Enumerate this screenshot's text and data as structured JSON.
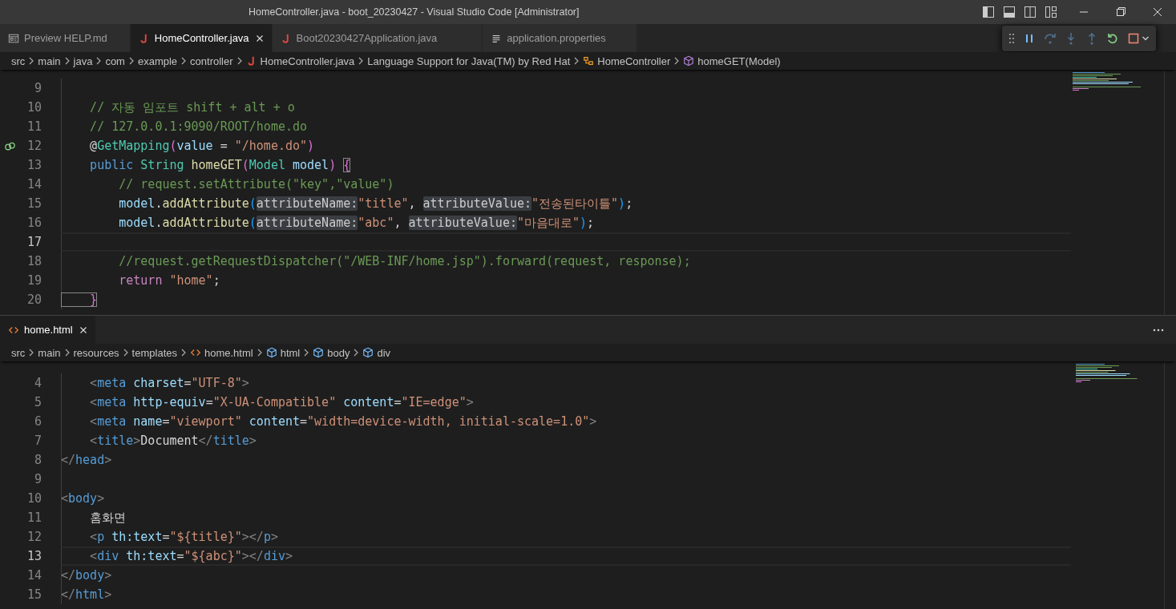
{
  "window": {
    "title": "HomeController.java - boot_20230427 - Visual Studio Code [Administrator]"
  },
  "debug_toolbar": [
    {
      "kind": "pause",
      "disabled": false
    },
    {
      "kind": "step-over",
      "disabled": true
    },
    {
      "kind": "step-into",
      "disabled": true
    },
    {
      "kind": "step-out",
      "disabled": true
    },
    {
      "kind": "restart",
      "disabled": false
    },
    {
      "kind": "stop",
      "disabled": false
    }
  ],
  "groups": [
    {
      "tabs": [
        {
          "label": "Preview HELP.md",
          "kind": "preview",
          "selected": false
        },
        {
          "label": "HomeController.java",
          "kind": "java",
          "selected": true
        },
        {
          "label": "Boot20230427Application.java",
          "kind": "java",
          "selected": false
        },
        {
          "label": "application.properties",
          "kind": "lines",
          "selected": false
        }
      ],
      "breadcrumbs": [
        {
          "label": "src",
          "kind": "folder"
        },
        {
          "label": "main",
          "kind": "folder"
        },
        {
          "label": "java",
          "kind": "folder"
        },
        {
          "label": "com",
          "kind": "folder"
        },
        {
          "label": "example",
          "kind": "folder"
        },
        {
          "label": "controller",
          "kind": "folder"
        },
        {
          "label": "HomeController.java",
          "kind": "java"
        },
        {
          "label": "Language Support for Java(TM) by Red Hat",
          "kind": "folder"
        },
        {
          "label": "HomeController",
          "kind": "class"
        },
        {
          "label": "homeGET(Model)",
          "kind": "method"
        }
      ],
      "lines": [
        {
          "number": "9",
          "kind": "code",
          "current": false
        },
        {
          "number": "10",
          "kind": "code",
          "current": false,
          "tokens": [
            {
              "kind": "comment",
              "text": "    // 자동 임포트 shift + alt + o"
            }
          ]
        },
        {
          "number": "11",
          "kind": "code",
          "current": false,
          "tokens": [
            {
              "kind": "comment",
              "text": "    // 127.0.0.1:9090/ROOT/home.do"
            }
          ]
        },
        {
          "number": "12",
          "kind": "mapping",
          "current": false,
          "tokens": [
            {
              "kind": "plain",
              "text": "    @"
            },
            {
              "kind": "type",
              "text": "GetMapping"
            },
            {
              "kind": "bracket2",
              "text": "("
            },
            {
              "kind": "variable",
              "text": "value"
            },
            {
              "kind": "plain",
              "text": " = "
            },
            {
              "kind": "string",
              "text": "\"/home.do\""
            },
            {
              "kind": "bracket2",
              "text": ")"
            }
          ]
        },
        {
          "number": "13",
          "kind": "code",
          "current": false,
          "tokens": [
            {
              "kind": "keyword",
              "text": "    public "
            },
            {
              "kind": "type",
              "text": "String "
            },
            {
              "kind": "function",
              "text": "homeGET"
            },
            {
              "kind": "bracket2",
              "text": "("
            },
            {
              "kind": "type",
              "text": "Model "
            },
            {
              "kind": "variable",
              "text": "model"
            },
            {
              "kind": "bracket2",
              "text": ") "
            },
            {
              "kind": "bracket-match",
              "text": "{"
            }
          ]
        },
        {
          "number": "14",
          "kind": "code",
          "current": false,
          "tokens": [
            {
              "kind": "comment",
              "text": "        // request.setAttribute(\"key\",\"value\")"
            }
          ]
        },
        {
          "number": "15",
          "kind": "code",
          "current": false,
          "tokens": [
            {
              "kind": "variable",
              "text": "        model"
            },
            {
              "kind": "plain",
              "text": "."
            },
            {
              "kind": "function",
              "text": "addAttribute"
            },
            {
              "kind": "bracket3",
              "text": "("
            },
            {
              "kind": "hint",
              "text": "attributeName:"
            },
            {
              "kind": "string",
              "text": "\"title\""
            },
            {
              "kind": "plain",
              "text": ", "
            },
            {
              "kind": "hint",
              "text": "attributeValue:"
            },
            {
              "kind": "string",
              "text": "\"전송된타이틀\""
            },
            {
              "kind": "bracket3",
              "text": ")"
            },
            {
              "kind": "plain",
              "text": ";"
            }
          ]
        },
        {
          "number": "16",
          "kind": "code",
          "current": false,
          "tokens": [
            {
              "kind": "variable",
              "text": "        model"
            },
            {
              "kind": "plain",
              "text": "."
            },
            {
              "kind": "function",
              "text": "addAttribute"
            },
            {
              "kind": "bracket3",
              "text": "("
            },
            {
              "kind": "hint",
              "text": "attributeName:"
            },
            {
              "kind": "string",
              "text": "\"abc\""
            },
            {
              "kind": "plain",
              "text": ", "
            },
            {
              "kind": "hint",
              "text": "attributeValue:"
            },
            {
              "kind": "string",
              "text": "\"마음대로\""
            },
            {
              "kind": "bracket3",
              "text": ")"
            },
            {
              "kind": "plain",
              "text": ";"
            }
          ]
        },
        {
          "number": "17",
          "kind": "code",
          "current": true
        },
        {
          "number": "18",
          "kind": "code",
          "current": false,
          "tokens": [
            {
              "kind": "comment",
              "text": "        //request.getRequestDispatcher(\"/WEB-INF/home.jsp\").forward(request, response);"
            }
          ]
        },
        {
          "number": "19",
          "kind": "code",
          "current": false,
          "tokens": [
            {
              "kind": "control",
              "text": "        return "
            },
            {
              "kind": "string",
              "text": "\"home\""
            },
            {
              "kind": "plain",
              "text": ";"
            }
          ]
        },
        {
          "number": "20",
          "kind": "code",
          "current": false,
          "tokens": [
            {
              "kind": "bracket-match",
              "text": "    }"
            }
          ]
        }
      ]
    },
    {
      "tabs": [
        {
          "label": "home.html",
          "kind": "html",
          "selected": true
        }
      ],
      "breadcrumbs": [
        {
          "label": "src",
          "kind": "folder"
        },
        {
          "label": "main",
          "kind": "folder"
        },
        {
          "label": "resources",
          "kind": "folder"
        },
        {
          "label": "templates",
          "kind": "folder"
        },
        {
          "label": "home.html",
          "kind": "html"
        },
        {
          "label": "html",
          "kind": "element"
        },
        {
          "label": "body",
          "kind": "element"
        },
        {
          "label": "div",
          "kind": "element"
        }
      ],
      "lines": [
        {
          "number": "4",
          "kind": "code",
          "current": false,
          "tokens": [
            {
              "kind": "tag-punct",
              "text": "    <"
            },
            {
              "kind": "tag",
              "text": "meta "
            },
            {
              "kind": "attr",
              "text": "charset"
            },
            {
              "kind": "plain",
              "text": "="
            },
            {
              "kind": "string",
              "text": "\"UTF-8\""
            },
            {
              "kind": "tag-punct",
              "text": ">"
            }
          ]
        },
        {
          "number": "5",
          "kind": "code",
          "current": false,
          "tokens": [
            {
              "kind": "tag-punct",
              "text": "    <"
            },
            {
              "kind": "tag",
              "text": "meta "
            },
            {
              "kind": "attr",
              "text": "http-equiv"
            },
            {
              "kind": "plain",
              "text": "="
            },
            {
              "kind": "string",
              "text": "\"X-UA-Compatible\""
            },
            {
              "kind": "attr",
              "text": " content"
            },
            {
              "kind": "plain",
              "text": "="
            },
            {
              "kind": "string",
              "text": "\"IE=edge\""
            },
            {
              "kind": "tag-punct",
              "text": ">"
            }
          ]
        },
        {
          "number": "6",
          "kind": "code",
          "current": false,
          "tokens": [
            {
              "kind": "tag-punct",
              "text": "    <"
            },
            {
              "kind": "tag",
              "text": "meta "
            },
            {
              "kind": "attr",
              "text": "name"
            },
            {
              "kind": "plain",
              "text": "="
            },
            {
              "kind": "string",
              "text": "\"viewport\""
            },
            {
              "kind": "attr",
              "text": " content"
            },
            {
              "kind": "plain",
              "text": "="
            },
            {
              "kind": "string",
              "text": "\"width=device-width, initial-scale=1.0\""
            },
            {
              "kind": "tag-punct",
              "text": ">"
            }
          ]
        },
        {
          "number": "7",
          "kind": "code",
          "current": false,
          "tokens": [
            {
              "kind": "tag-punct",
              "text": "    <"
            },
            {
              "kind": "tag",
              "text": "title"
            },
            {
              "kind": "tag-punct",
              "text": ">"
            },
            {
              "kind": "plain",
              "text": "Document"
            },
            {
              "kind": "tag-punct",
              "text": "</"
            },
            {
              "kind": "tag",
              "text": "title"
            },
            {
              "kind": "tag-punct",
              "text": ">"
            }
          ]
        },
        {
          "number": "8",
          "kind": "code",
          "current": false,
          "tokens": [
            {
              "kind": "tag-punct",
              "text": "</"
            },
            {
              "kind": "tag",
              "text": "head"
            },
            {
              "kind": "tag-punct",
              "text": ">"
            }
          ]
        },
        {
          "number": "9",
          "kind": "code",
          "current": false
        },
        {
          "number": "10",
          "kind": "code",
          "current": false,
          "tokens": [
            {
              "kind": "tag-punct",
              "text": "<"
            },
            {
              "kind": "tag",
              "text": "body"
            },
            {
              "kind": "tag-punct",
              "text": ">"
            }
          ]
        },
        {
          "number": "11",
          "kind": "code",
          "current": false,
          "tokens": [
            {
              "kind": "plain",
              "text": "    홈화면"
            }
          ]
        },
        {
          "number": "12",
          "kind": "code",
          "current": false,
          "tokens": [
            {
              "kind": "tag-punct",
              "text": "    <"
            },
            {
              "kind": "tag",
              "text": "p "
            },
            {
              "kind": "attr",
              "text": "th:text"
            },
            {
              "kind": "plain",
              "text": "="
            },
            {
              "kind": "string",
              "text": "\"${title}\""
            },
            {
              "kind": "tag-punct",
              "text": "></"
            },
            {
              "kind": "tag",
              "text": "p"
            },
            {
              "kind": "tag-punct",
              "text": ">"
            }
          ]
        },
        {
          "number": "13",
          "kind": "code",
          "current": true,
          "tokens": [
            {
              "kind": "tag-punct",
              "text": "    <"
            },
            {
              "kind": "tag",
              "text": "div "
            },
            {
              "kind": "attr",
              "text": "th:text"
            },
            {
              "kind": "plain",
              "text": "="
            },
            {
              "kind": "string",
              "text": "\"${abc}\""
            },
            {
              "kind": "tag-punct",
              "text": "></"
            },
            {
              "kind": "tag",
              "text": "div"
            },
            {
              "kind": "tag-punct",
              "text": ">"
            }
          ]
        },
        {
          "number": "14",
          "kind": "code",
          "current": false,
          "tokens": [
            {
              "kind": "tag-punct",
              "text": "</"
            },
            {
              "kind": "tag",
              "text": "body"
            },
            {
              "kind": "tag-punct",
              "text": ">"
            }
          ]
        },
        {
          "number": "15",
          "kind": "code",
          "current": false,
          "tokens": [
            {
              "kind": "tag-punct",
              "text": "</"
            },
            {
              "kind": "tag",
              "text": "html"
            },
            {
              "kind": "tag-punct",
              "text": ">"
            }
          ]
        }
      ]
    }
  ]
}
